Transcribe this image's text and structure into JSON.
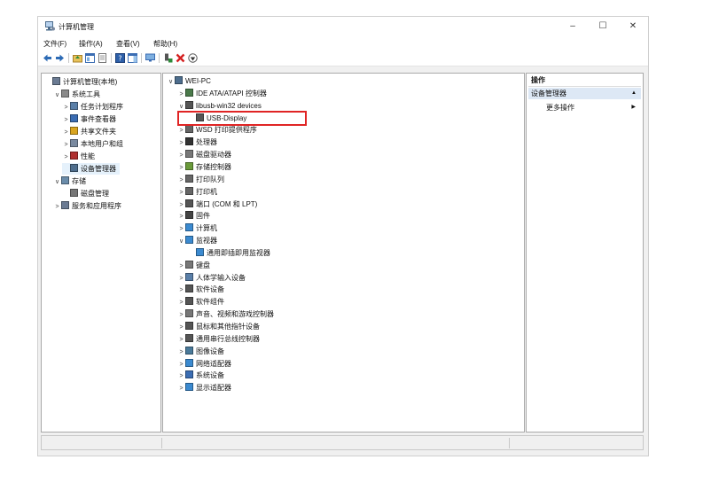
{
  "window": {
    "title": "计算机管理",
    "minimize": "–",
    "maximize": "☐",
    "close": "✕"
  },
  "menu": [
    "文件(F)",
    "操作(A)",
    "查看(V)",
    "帮助(H)"
  ],
  "left_tree": [
    {
      "label": "计算机管理(本地)",
      "chevron": "",
      "indent": 0,
      "icon_color": "#6b7b93"
    },
    {
      "label": "系统工具",
      "chevron": "∨",
      "indent": 1,
      "icon_color": "#8a8a8a"
    },
    {
      "label": "任务计划程序",
      "chevron": ">",
      "indent": 2,
      "icon_color": "#5a7fa8"
    },
    {
      "label": "事件查看器",
      "chevron": ">",
      "indent": 2,
      "icon_color": "#3b6db3"
    },
    {
      "label": "共享文件夹",
      "chevron": ">",
      "indent": 2,
      "icon_color": "#d9a520"
    },
    {
      "label": "本地用户和组",
      "chevron": ">",
      "indent": 2,
      "icon_color": "#7a8aa0"
    },
    {
      "label": "性能",
      "chevron": ">",
      "indent": 2,
      "icon_color": "#b03030"
    },
    {
      "label": "设备管理器",
      "chevron": "",
      "indent": 2,
      "icon_color": "#4d6d8d"
    },
    {
      "label": "存储",
      "chevron": "∨",
      "indent": 1,
      "icon_color": "#6a8caa"
    },
    {
      "label": "磁盘管理",
      "chevron": "",
      "indent": 2,
      "icon_color": "#777777"
    },
    {
      "label": "服务和应用程序",
      "chevron": ">",
      "indent": 1,
      "icon_color": "#6b7b93"
    }
  ],
  "device_tree": [
    {
      "label": "WEI-PC",
      "chevron": "∨",
      "indent": 0,
      "icon_color": "#4d6d8d"
    },
    {
      "label": "IDE ATA/ATAPI 控制器",
      "chevron": ">",
      "indent": 1,
      "icon_color": "#4a7a4a"
    },
    {
      "label": "libusb-win32 devices",
      "chevron": "∨",
      "indent": 1,
      "icon_color": "#555555"
    },
    {
      "label": "USB-Display",
      "chevron": "",
      "indent": 2,
      "icon_color": "#555555"
    },
    {
      "label": "WSD 打印提供程序",
      "chevron": ">",
      "indent": 1,
      "icon_color": "#666666"
    },
    {
      "label": "处理器",
      "chevron": ">",
      "indent": 1,
      "icon_color": "#333333"
    },
    {
      "label": "磁盘驱动器",
      "chevron": ">",
      "indent": 1,
      "icon_color": "#777777"
    },
    {
      "label": "存储控制器",
      "chevron": ">",
      "indent": 1,
      "icon_color": "#6a9a3a"
    },
    {
      "label": "打印队列",
      "chevron": ">",
      "indent": 1,
      "icon_color": "#666666"
    },
    {
      "label": "打印机",
      "chevron": ">",
      "indent": 1,
      "icon_color": "#666666"
    },
    {
      "label": "端口 (COM 和 LPT)",
      "chevron": ">",
      "indent": 1,
      "icon_color": "#555555"
    },
    {
      "label": "固件",
      "chevron": ">",
      "indent": 1,
      "icon_color": "#444444"
    },
    {
      "label": "计算机",
      "chevron": ">",
      "indent": 1,
      "icon_color": "#3b8ad0"
    },
    {
      "label": "监视器",
      "chevron": "∨",
      "indent": 1,
      "icon_color": "#3b8ad0"
    },
    {
      "label": "通用即插即用监视器",
      "chevron": "",
      "indent": 2,
      "icon_color": "#3b8ad0"
    },
    {
      "label": "键盘",
      "chevron": ">",
      "indent": 1,
      "icon_color": "#777777"
    },
    {
      "label": "人体学输入设备",
      "chevron": ">",
      "indent": 1,
      "icon_color": "#5a7fa8"
    },
    {
      "label": "软件设备",
      "chevron": ">",
      "indent": 1,
      "icon_color": "#555555"
    },
    {
      "label": "软件组件",
      "chevron": ">",
      "indent": 1,
      "icon_color": "#555555"
    },
    {
      "label": "声音、视频和游戏控制器",
      "chevron": ">",
      "indent": 1,
      "icon_color": "#777777"
    },
    {
      "label": "鼠标和其他指针设备",
      "chevron": ">",
      "indent": 1,
      "icon_color": "#555555"
    },
    {
      "label": "通用串行总线控制器",
      "chevron": ">",
      "indent": 1,
      "icon_color": "#555555"
    },
    {
      "label": "图像设备",
      "chevron": ">",
      "indent": 1,
      "icon_color": "#4a7a9a"
    },
    {
      "label": "网络适配器",
      "chevron": ">",
      "indent": 1,
      "icon_color": "#3b8ad0"
    },
    {
      "label": "系统设备",
      "chevron": ">",
      "indent": 1,
      "icon_color": "#3b6db3"
    },
    {
      "label": "显示适配器",
      "chevron": ">",
      "indent": 1,
      "icon_color": "#3b8ad0"
    }
  ],
  "actions": {
    "header": "操作",
    "section": "设备管理器",
    "section_arrow": "▲",
    "more": "更多操作",
    "more_arrow": "▶"
  },
  "colors": {
    "highlight_box": "#e02424",
    "selected_row": "#e5f1fb",
    "section_bg": "#dde8f5"
  }
}
